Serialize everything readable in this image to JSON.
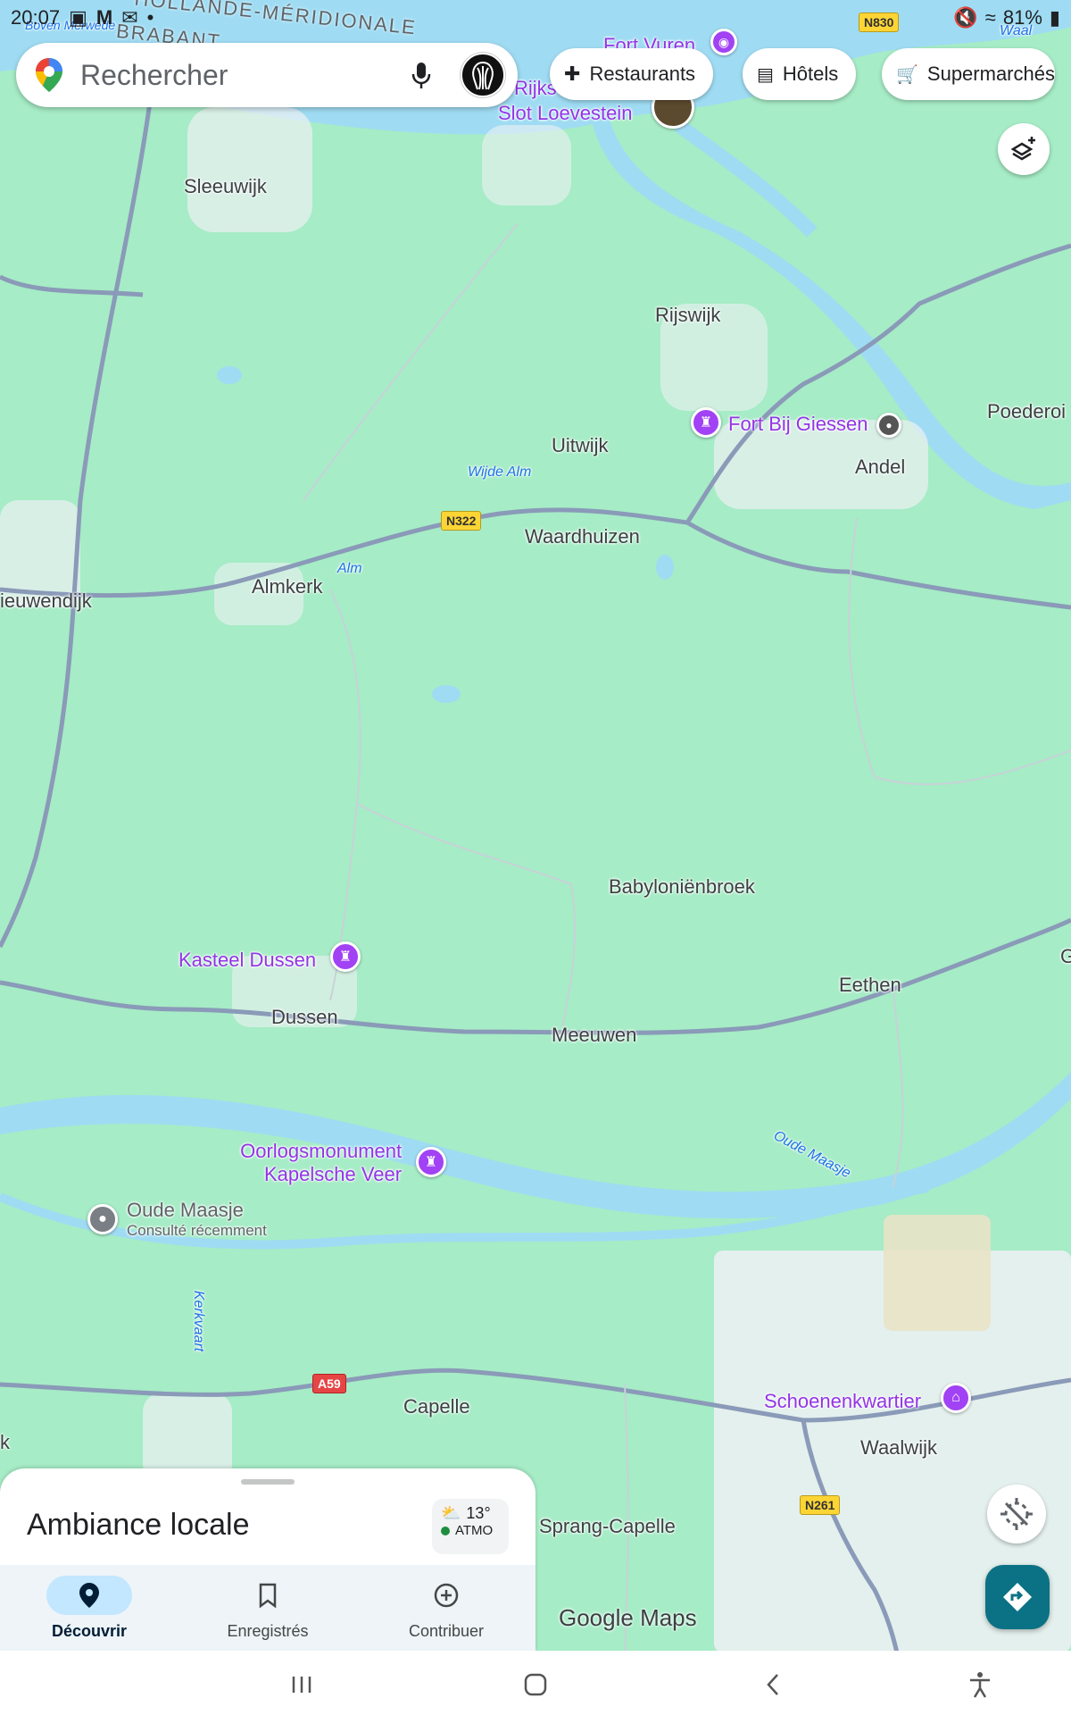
{
  "status_bar": {
    "time": "20:07",
    "notification_icons": [
      "image-icon",
      "gmail-icon",
      "mail-icon",
      "dot-icon"
    ],
    "battery": "81%"
  },
  "search": {
    "placeholder": "Rechercher"
  },
  "chips": [
    {
      "label": "Restaurants",
      "icon": "fork-knife-icon"
    },
    {
      "label": "Hôtels",
      "icon": "bed-icon"
    },
    {
      "label": "Supermarchés",
      "icon": "cart-icon"
    }
  ],
  "map": {
    "region_labels": [
      "HOLLANDE-MÉRIDIONALE",
      "BRABANT"
    ],
    "places": {
      "boven_merwede": "Boven Merwede",
      "waal": "Waal",
      "sleeuwijk": "Sleeuwijk",
      "rijswijk": "Rijswijk",
      "uitwijk": "Uitwijk",
      "wijde_alm": "Wijde Alm",
      "andel": "Andel",
      "poederoijen": "Poederoi",
      "waardhuizen": "Waardhuizen",
      "almkerk": "Almkerk",
      "alm": "Alm",
      "nieuwendijk": "ieuwendijk",
      "babylonienbroek": "Babyloniënbroek",
      "eethen": "Eethen",
      "dussen": "Dussen",
      "meeuwen": "Meeuwen",
      "oude_maasje_river": "Oude Maasje",
      "kerkvaart": "Kerkvaart",
      "capelle": "Capelle",
      "waalwijk": "Waalwijk",
      "sprang_capelle": "Sprang-Capelle",
      "edge_g": "G",
      "edge_k": "k"
    },
    "pois": {
      "fort_vuren": "Fort Vuren",
      "slot_loevestein": "Slot Loevestein",
      "rijks": "Rijks",
      "fort_bij_giessen": "Fort Bij Giessen",
      "kasteel_dussen": "Kasteel Dussen",
      "oorlogsmonument_line1": "Oorlogsmonument",
      "oorlogsmonument_line2": "Kapelsche Veer",
      "schoenenkwartier": "Schoenenkwartier",
      "oude_maasje_recent": "Oude Maasje",
      "oude_maasje_recent_sub": "Consulté récemment"
    },
    "road_shields": {
      "n830": "N830",
      "n322": "N322",
      "a59": "A59",
      "n261": "N261"
    },
    "colors": {
      "land": "#a6ecc6",
      "water": "#9fdcf3",
      "road": "#8a9ab8",
      "urban": "#eef1f3",
      "poi": "#a142f4"
    }
  },
  "logo": "Google Maps",
  "bottom_sheet": {
    "title": "Ambiance locale",
    "weather": {
      "temp": "13°",
      "aqi": "ATMO"
    },
    "nav": [
      {
        "label": "Découvrir",
        "icon": "location-pin-icon",
        "active": true
      },
      {
        "label": "Enregistrés",
        "icon": "bookmark-icon",
        "active": false
      },
      {
        "label": "Contribuer",
        "icon": "add-circle-icon",
        "active": false
      }
    ]
  },
  "system_nav": [
    "recents-icon",
    "home-icon",
    "back-icon",
    "accessibility-icon"
  ]
}
